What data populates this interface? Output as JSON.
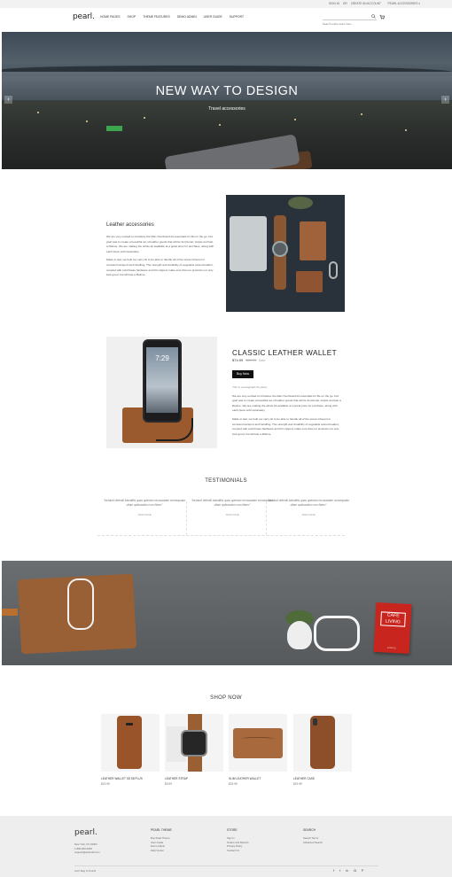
{
  "topbar": {
    "links": [
      "SIGN IN",
      "OR",
      "CREATE AN ACCOUNT"
    ],
    "store": "PEARL ACCESSORIES ▾"
  },
  "header": {
    "logo": "pearl.",
    "nav": [
      "HOME PAGES",
      "SHOP",
      "THEME FEATURES",
      "DEMO ADMIN",
      "USER GUIDE",
      "SUPPORT"
    ],
    "search_placeholder": "Search entire store here..."
  },
  "hero": {
    "title": "NEW WAY TO DESIGN",
    "subtitle": "Travel accessories",
    "prev": "‹",
    "next": "›"
  },
  "intro": {
    "title": "Leather accessories",
    "paragraphs": [
      "We are very excited to introduce the Man Overboard kit essentials for life on the go. Our goal was to create a beautiful set of leather goods that will be functional, simple and last a lifetime. We are making the whole kit available at a great price for purchase, along with each piece sold separately.",
      "Made to last, we built our carry kit to be able to handle all of the stress inherent in constant transport and handling. The strength and durability of vegetable tanned leather, coupled with solid brass hardware and thin zippers make sure that our products not only look good, but will last a lifetime."
    ]
  },
  "product": {
    "time": "7:29",
    "title": "CLASSIC LEATHER WALLET",
    "price": "$74.99",
    "old_price": "$89.99",
    "sale": "Sale",
    "buy_label": "Buy Now",
    "quote": "This is a paragraph for place",
    "paragraphs": [
      "We are very excited to introduce the Man Overboard kit essentials for life on the go. Our goal was to create a beautiful set of leather goods that will be functional, simple and last a lifetime. We are making the whole kit available at a great price for purchase, along with each piece sold separately.",
      "Made to last, we built our carry kit to be able to handle all of the stress inherent in constant transport and handling. The strength and durability of vegetable tanned leather, coupled with solid brass hardware and thin zippers make sure that our products not only look good, but will last a lifetime."
    ]
  },
  "testimonials": {
    "title": "TESTIMONIALS",
    "items": [
      {
        "quote": "\"Incidunt deleniti blanditiis quas aperiam recusandae consequatur ullam quibusdam cum libero\"",
        "author": "JOHN DOE"
      },
      {
        "quote": "\"Incidunt deleniti blanditiis quas aperiam recusandae consequatur ullam quibusdam cum libero\"",
        "author": "JOHN DOE"
      },
      {
        "quote": "\"Incidunt deleniti blanditiis quas aperiam recusandae consequatur ullam quibusdam cum libero\"",
        "author": "JOHN DOE"
      }
    ]
  },
  "banner": {
    "book_title": "CAFE LIVING",
    "book_sub": "SAMPLE"
  },
  "shop": {
    "title": "SHOP NOW",
    "items": [
      {
        "name": "LEATHER WALLET S8 S8 PLUS",
        "price": "$19.99"
      },
      {
        "name": "LEATHER STRAP",
        "price": "$9.99"
      },
      {
        "name": "SLIM LEATHER WALLET",
        "price": "$24.99"
      },
      {
        "name": "LEATHER CASE",
        "price": "$19.99"
      }
    ]
  },
  "footer": {
    "logo": "pearl.",
    "address": [
      "New York, NY 10001",
      "1-800-000-0000",
      "support@webmail.com"
    ],
    "columns": [
      {
        "heading": "PEARL THEME",
        "links": [
          "Buy Pearl Theme",
          "User Guide",
          "Demo Admin",
          "Help Center"
        ]
      },
      {
        "heading": "STORE",
        "links": [
          "Sign In",
          "Orders and Returns",
          "Privacy Policy",
          "Contact Us"
        ]
      },
      {
        "heading": "SEARCH",
        "links": [
          "Search Terms",
          "Advanced Search"
        ]
      }
    ],
    "copyright": "Let's Stay In Touch!",
    "social": [
      "f",
      "t",
      "in",
      "◘",
      "P"
    ]
  },
  "colors": {
    "button": "#111111",
    "footer_bg": "#eeeeee",
    "book": "#c9251f"
  }
}
